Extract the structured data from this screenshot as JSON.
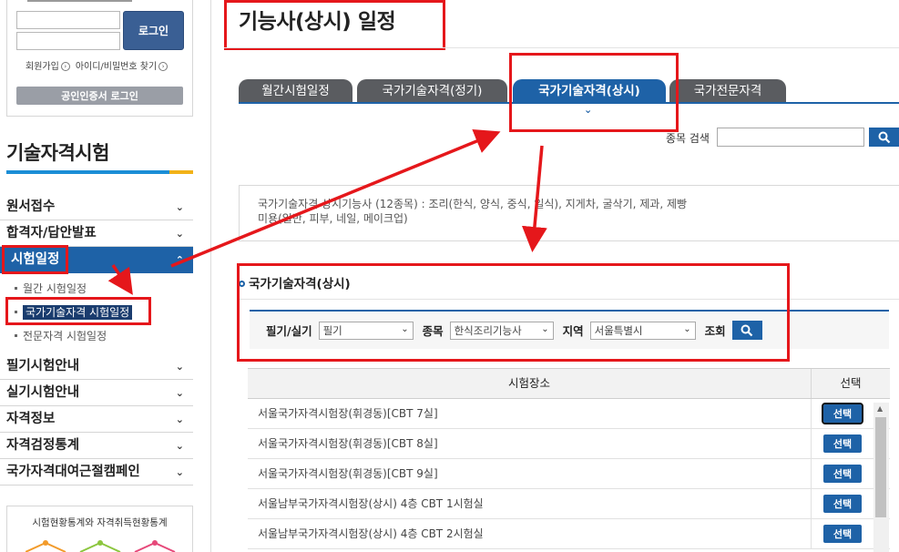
{
  "login": {
    "login_button": "로그인",
    "links": [
      {
        "label": "회원가입",
        "icon": "circle-arrow-icon"
      },
      {
        "label": "아이디/비밀번호 찾기",
        "icon": "circle-arrow-icon"
      }
    ],
    "cert_button": "공인인증서 로그인"
  },
  "sidebar": {
    "title": "기술자격시험",
    "menu": [
      {
        "label": "원서접수",
        "icon": "chevron-down-icon"
      },
      {
        "label": "합격자/답안발표",
        "icon": "chevron-down-icon"
      },
      {
        "label": "시험일정",
        "icon": "chevron-up-icon",
        "active": true
      },
      {
        "label": "필기시험안내",
        "icon": "chevron-down-icon"
      },
      {
        "label": "실기시험안내",
        "icon": "chevron-down-icon"
      },
      {
        "label": "자격정보",
        "icon": "chevron-down-icon"
      },
      {
        "label": "자격검정통계",
        "icon": "chevron-down-icon"
      },
      {
        "label": "국가자격대여근절캠페인",
        "icon": "chevron-down-icon"
      }
    ],
    "submenu": [
      {
        "label": "월간 시험일정"
      },
      {
        "label": "국가기술자격 시험일정",
        "current": true
      },
      {
        "label": "전문자격 시험일정"
      }
    ],
    "stats_title": "시험현황통계와 자격취득현황통계"
  },
  "main": {
    "page_title": "기능사(상시) 일정",
    "tabs": [
      {
        "label": "월간시험일정"
      },
      {
        "label": "국가기술자격(정기)"
      },
      {
        "label": "국가기술자격(상시)",
        "active": true
      },
      {
        "label": "국가전문자격"
      }
    ],
    "search_label": "종목 검색",
    "info_line1": "국가기술자격 상시기능사 (12종목) : 조리(한식, 양식, 중식, 일식), 지게차, 굴삭기, 제과, 제빵",
    "info_line2": "미용(일반, 피부, 네일, 메이크업)",
    "section_title": "국가기술자격(상시)",
    "filters": {
      "type_label": "필기/실기",
      "type_value": "필기",
      "subject_label": "종목",
      "subject_value": "한식조리기능사",
      "region_label": "지역",
      "region_value": "서울특별시",
      "lookup_label": "조회"
    },
    "table": {
      "headers": [
        "시험장소",
        "선택"
      ],
      "rows": [
        {
          "place": "서울국가자격시험장(휘경동)[CBT 7실]",
          "button": "선택",
          "focused": true
        },
        {
          "place": "서울국가자격시험장(휘경동)[CBT 8실]",
          "button": "선택"
        },
        {
          "place": "서울국가자격시험장(휘경동)[CBT 9실]",
          "button": "선택"
        },
        {
          "place": "서울남부국가자격시험장(상시) 4층 CBT 1시험실",
          "button": "선택"
        },
        {
          "place": "서울남부국가자격시험장(상시) 4층 CBT 2시험실",
          "button": "선택"
        }
      ]
    }
  },
  "colors": {
    "brand_blue": "#1e62a7",
    "tab_gray": "#5a5c60",
    "annotation_red": "#e5171b"
  }
}
